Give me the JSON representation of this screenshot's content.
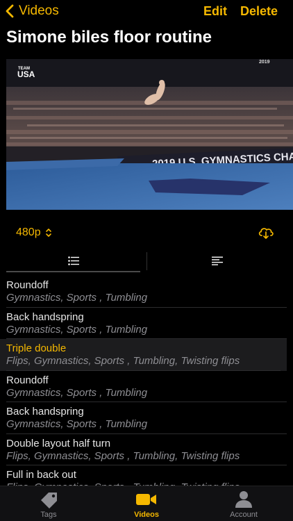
{
  "nav": {
    "back_label": "Videos",
    "edit_label": "Edit",
    "delete_label": "Delete"
  },
  "title": "Simone biles floor routine",
  "video": {
    "logo_small": "TEAM",
    "logo_big": "USA",
    "banner_text": "2019 U.S. GYMNASTICS CHA",
    "corner_text": "2019"
  },
  "quality": {
    "value": "480p"
  },
  "moves": [
    {
      "name": "Roundoff",
      "tags": "Gymnastics, Sports , Tumbling",
      "selected": false
    },
    {
      "name": "Back handspring",
      "tags": "Gymnastics, Sports , Tumbling",
      "selected": false
    },
    {
      "name": "Triple double",
      "tags": "Flips, Gymnastics, Sports , Tumbling, Twisting flips",
      "selected": true
    },
    {
      "name": "Roundoff",
      "tags": "Gymnastics, Sports , Tumbling",
      "selected": false
    },
    {
      "name": "Back handspring",
      "tags": "Gymnastics, Sports , Tumbling",
      "selected": false
    },
    {
      "name": "Double layout half turn",
      "tags": "Flips, Gymnastics, Sports , Tumbling, Twisting flips",
      "selected": false
    },
    {
      "name": "Full in back out",
      "tags": "Flips, Gymnastics, Sports , Tumbling, Twisting flips",
      "selected": false
    }
  ],
  "tabbar": {
    "tags_label": "Tags",
    "videos_label": "Videos",
    "account_label": "Account"
  },
  "colors": {
    "accent": "#f5b800",
    "background": "#000000",
    "muted": "#8e8e93"
  }
}
